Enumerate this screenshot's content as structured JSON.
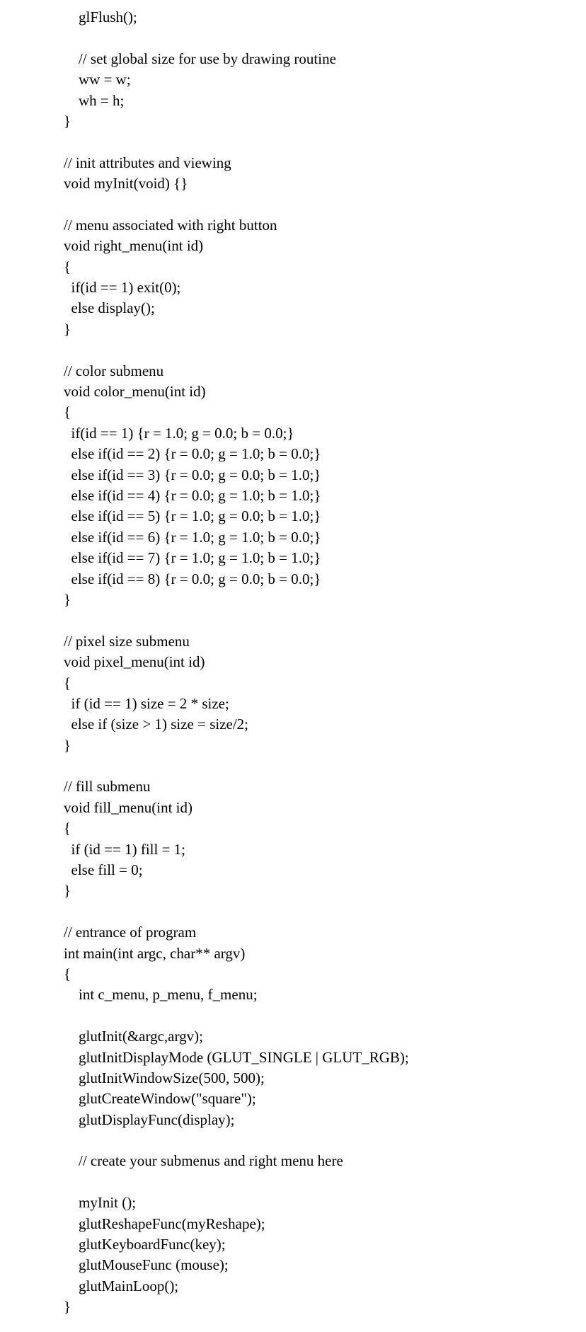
{
  "code_lines": [
    "    glFlush();",
    "",
    "    // set global size for use by drawing routine",
    "    ww = w;",
    "    wh = h;",
    "}",
    "",
    "// init attributes and viewing",
    "void myInit(void) {}",
    "",
    "// menu associated with right button",
    "void right_menu(int id)",
    "{",
    "  if(id == 1) exit(0);",
    "  else display();",
    "}",
    "",
    "// color submenu",
    "void color_menu(int id)",
    "{",
    "  if(id == 1) {r = 1.0; g = 0.0; b = 0.0;}",
    "  else if(id == 2) {r = 0.0; g = 1.0; b = 0.0;}",
    "  else if(id == 3) {r = 0.0; g = 0.0; b = 1.0;}",
    "  else if(id == 4) {r = 0.0; g = 1.0; b = 1.0;}",
    "  else if(id == 5) {r = 1.0; g = 0.0; b = 1.0;}",
    "  else if(id == 6) {r = 1.0; g = 1.0; b = 0.0;}",
    "  else if(id == 7) {r = 1.0; g = 1.0; b = 1.0;}",
    "  else if(id == 8) {r = 0.0; g = 0.0; b = 0.0;}",
    "}",
    "",
    "// pixel size submenu",
    "void pixel_menu(int id)",
    "{",
    "  if (id == 1) size = 2 * size;",
    "  else if (size > 1) size = size/2;",
    "}",
    "",
    "// fill submenu",
    "void fill_menu(int id)",
    "{",
    "  if (id == 1) fill = 1;",
    "  else fill = 0;",
    "}",
    "",
    "// entrance of program",
    "int main(int argc, char** argv)",
    "{",
    "    int c_menu, p_menu, f_menu;",
    "",
    "    glutInit(&argc,argv);",
    "    glutInitDisplayMode (GLUT_SINGLE | GLUT_RGB);",
    "    glutInitWindowSize(500, 500);",
    "    glutCreateWindow(\"square\");",
    "    glutDisplayFunc(display);",
    "",
    "    // create your submenus and right menu here",
    "",
    "    myInit ();",
    "    glutReshapeFunc(myReshape);",
    "    glutKeyboardFunc(key);",
    "    glutMouseFunc (mouse);",
    "    glutMainLoop();",
    "}"
  ]
}
